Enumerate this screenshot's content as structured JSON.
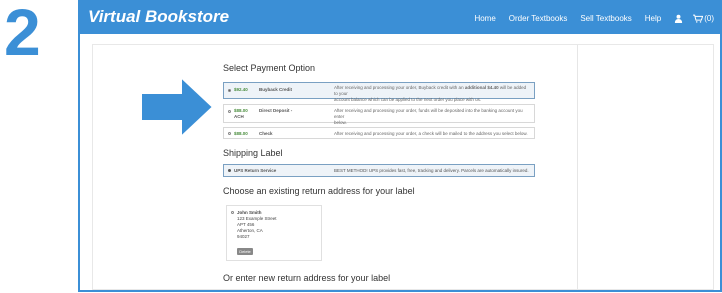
{
  "step": "2",
  "brand": "Virtual Bookstore",
  "colors": {
    "accent": "#3b8fd6",
    "price_green": "#4a8d3e"
  },
  "nav": {
    "home": "Home",
    "order": "Order Textbooks",
    "sell": "Sell Textbooks",
    "help": "Help",
    "cart_count": "(0)",
    "icons": [
      "user-icon",
      "cart-icon"
    ]
  },
  "payment": {
    "heading": "Select Payment Option",
    "options": [
      {
        "price": "$92.40",
        "name": "Buyback Credit",
        "desc1": "After receiving and processing your order, Buyback credit with an",
        "desc1b": "additional $4.40",
        "desc1c": "will be added to your",
        "desc2": "account balance which can be applied to the next order you place with us.",
        "selected": true
      },
      {
        "price": "$88.00",
        "name": "Direct Deposit -",
        "name2": "ACH",
        "desc1": "After receiving and processing your order, funds will be deposited into the banking account you enter",
        "desc2": "below.",
        "selected": false
      },
      {
        "price": "$88.00",
        "name": "Check",
        "desc1": "After receiving and processing your order, a check will be mailed to the address you select below.",
        "selected": false
      }
    ]
  },
  "shipping": {
    "heading": "Shipping Label",
    "service": "UPS Return Service",
    "desc": "BEST METHOD! UPS provides fast, free, tracking and delivery. Parcels are automatically insured."
  },
  "return_address": {
    "heading": "Choose an existing return address for your label",
    "name": "John Smith",
    "street": "123 Example Street",
    "apt": "APT 456",
    "city": "Atherton, CA",
    "zip": "94027",
    "delete_label": "Delete"
  },
  "new_address": {
    "heading": "Or enter new return address for your label"
  }
}
